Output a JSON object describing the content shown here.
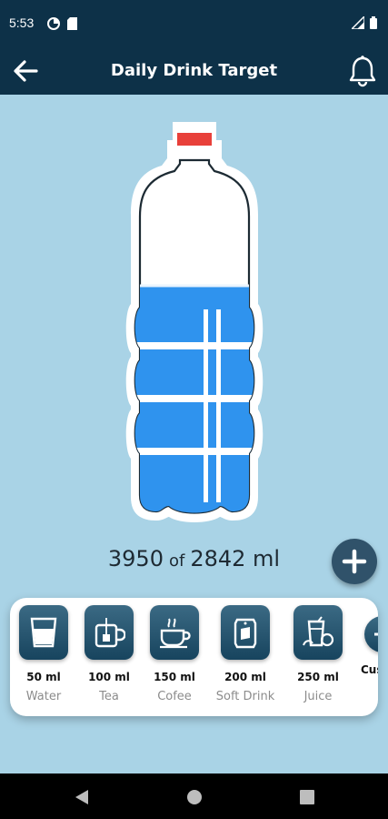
{
  "status_bar": {
    "time": "5:53",
    "icons": [
      "data-saver-icon",
      "sim-card-icon",
      "signal-icon",
      "battery-icon"
    ]
  },
  "app_bar": {
    "title": "Daily Drink Target",
    "back_icon": "arrow-left-icon",
    "notification_icon": "bell-icon"
  },
  "bottle": {
    "fill_fraction": 0.65,
    "water_color": "#2f93ee",
    "cap_color": "#e8403a"
  },
  "progress": {
    "current": "3950",
    "of_label": "of",
    "target": "2842",
    "unit": "ml"
  },
  "drinks": [
    {
      "amount": "50 ml",
      "name": "Water",
      "icon": "glass-icon"
    },
    {
      "amount": "100 ml",
      "name": "Tea",
      "icon": "tea-bag-icon"
    },
    {
      "amount": "150 ml",
      "name": "Cofee",
      "icon": "coffee-cup-icon"
    },
    {
      "amount": "200 ml",
      "name": "Soft Drink",
      "icon": "soda-can-icon"
    },
    {
      "amount": "250 ml",
      "name": "Juice",
      "icon": "juice-glass-icon"
    },
    {
      "amount": "Cus",
      "name": "",
      "icon": "add-custom-icon"
    }
  ],
  "colors": {
    "background": "#a9d3e6",
    "header": "#0d3148",
    "tile": "#17445e"
  }
}
